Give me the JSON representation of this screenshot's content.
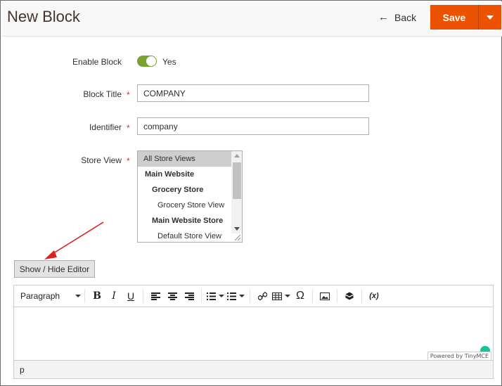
{
  "header": {
    "title": "New Block",
    "back_label": "Back",
    "save_label": "Save"
  },
  "form": {
    "enable": {
      "label": "Enable Block",
      "value_text": "Yes",
      "enabled": true
    },
    "title": {
      "label": "Block Title",
      "required_mark": "*",
      "value": "COMPANY"
    },
    "identifier": {
      "label": "Identifier",
      "required_mark": "*",
      "value": "company"
    },
    "store_view": {
      "label": "Store View",
      "required_mark": "*",
      "options": [
        "All Store Views",
        "Main Website",
        "Grocery Store",
        "Grocery Store View",
        "Main Website Store",
        "Default Store View"
      ],
      "selected": "All Store Views"
    }
  },
  "show_hide_label": "Show / Hide Editor",
  "editor": {
    "format_label": "Paragraph",
    "variable_label": "(x)",
    "powered_by": "Powered by TinyMCE",
    "path": "p"
  },
  "colors": {
    "accent": "#eb5202",
    "toggle_on": "#79a22e",
    "required": "#e22626",
    "annotation_arrow": "#e02020"
  }
}
